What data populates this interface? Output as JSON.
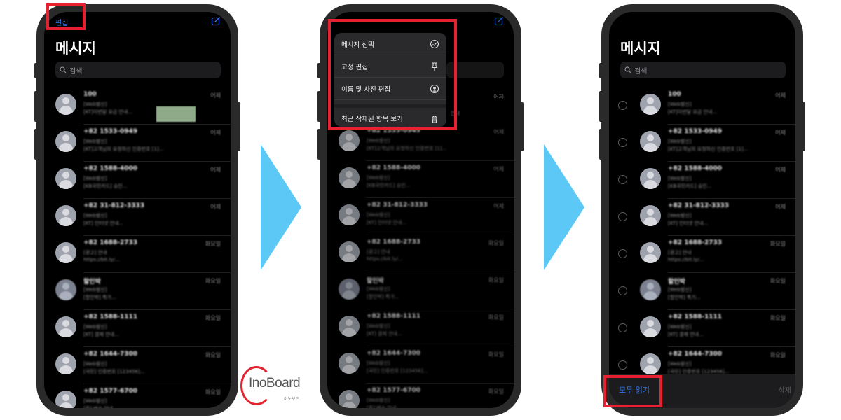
{
  "colors": {
    "highlight": "#e8202f",
    "accent_blue": "#2f7df6",
    "arrow": "#5bc8f5",
    "phone_frame": "#2a2a2a"
  },
  "screen1": {
    "edit_label": "편집",
    "title": "메시지",
    "search_placeholder": "검색"
  },
  "screen2": {
    "menu": [
      {
        "label": "메시지 선택",
        "icon": "checkmark-circle-icon"
      },
      {
        "label": "고정 편집",
        "icon": "pin-icon"
      },
      {
        "label": "이름 및 사진 편집",
        "icon": "person-circle-icon"
      },
      {
        "label": "최근 삭제된 항목 보기",
        "icon": "trash-icon"
      }
    ],
    "peek_time": "어제",
    "peek_text": "안내"
  },
  "screen3": {
    "title": "메시지",
    "search_placeholder": "검색",
    "read_all_label": "모두 읽기",
    "delete_label": "삭제"
  },
  "conversations": [
    {
      "sender": "100",
      "time": "어제",
      "line1": "[Web발신]",
      "line2": "[KT]이번달 요금 안내...",
      "avatar": "default"
    },
    {
      "sender": "+82 1533-0949",
      "time": "어제",
      "line1": "[Web발신]",
      "line2": "[KT]고객님의 요청하신 인증번호 [1]...",
      "avatar": "default"
    },
    {
      "sender": "+82 1588-4000",
      "time": "어제",
      "line1": "[Web발신]",
      "line2": "[KB국민카드] 승인...",
      "avatar": "default"
    },
    {
      "sender": "+82 31-812-3333",
      "time": "어제",
      "line1": "[Web발신]",
      "line2": "[KT] 인터넷 안내...",
      "avatar": "default"
    },
    {
      "sender": "+82 1688-2733",
      "time": "화요일",
      "line1": "[광고] 안내",
      "line2": "https://bit.ly/...",
      "avatar": "default"
    },
    {
      "sender": "할인박",
      "time": "화요일",
      "line1": "[Web발신]",
      "line2": "[할인박] 특가...",
      "avatar": "photo"
    },
    {
      "sender": "+82 1588-1111",
      "time": "화요일",
      "line1": "[Web발신]",
      "line2": "[KT] 결제 안내...",
      "avatar": "default"
    },
    {
      "sender": "+82 1644-7300",
      "time": "화요일",
      "line1": "[Web발신]",
      "line2": "[국민] 인증번호 [123456]...",
      "avatar": "default"
    },
    {
      "sender": "+82 1577-6700",
      "time": "화요일",
      "line1": "[Web발신]",
      "line2": "[홈] 배송 안내...",
      "avatar": "default"
    }
  ],
  "logo": {
    "text": "InoBoard",
    "subtext": "이노보드"
  }
}
